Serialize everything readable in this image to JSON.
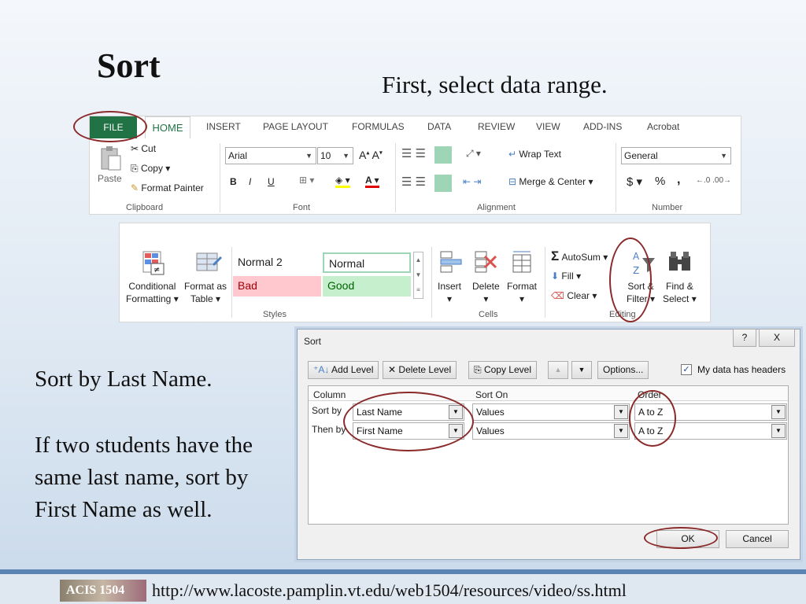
{
  "slide": {
    "title": "Sort",
    "subtitle": "First, select data range.",
    "note1": "Sort by Last Name.",
    "note2": "If two students have the same last name, sort by First Name as well.",
    "footer_badge": "ACIS 1504",
    "footer_url": "http://www.lacoste.pamplin.vt.edu/web1504/resources/video/ss.html"
  },
  "ribbon": {
    "tabs": [
      "FILE",
      "HOME",
      "INSERT",
      "PAGE LAYOUT",
      "FORMULAS",
      "DATA",
      "REVIEW",
      "VIEW",
      "ADD-INS",
      "Acrobat"
    ],
    "clipboard": {
      "paste": "Paste",
      "cut": "Cut",
      "copy": "Copy",
      "format_painter": "Format Painter",
      "group": "Clipboard"
    },
    "font": {
      "name": "Arial",
      "size": "10",
      "bold": "B",
      "italic": "I",
      "underline": "U",
      "group": "Font"
    },
    "alignment": {
      "wrap_text": "Wrap Text",
      "merge_center": "Merge & Center",
      "group": "Alignment"
    },
    "number": {
      "format": "General",
      "currency": "$",
      "percent": "%",
      "comma": ",",
      "group": "Number"
    }
  },
  "ribbon2": {
    "conditional_formatting": [
      "Conditional",
      "Formatting"
    ],
    "format_as_table": [
      "Format as",
      "Table"
    ],
    "styles": [
      {
        "label": "Normal 2",
        "bg": "#ffffff",
        "color": "#222222"
      },
      {
        "label": "Normal",
        "bg": "#ffffff",
        "color": "#222222"
      },
      {
        "label": "Bad",
        "bg": "#ffc7ce",
        "color": "#9c0006"
      },
      {
        "label": "Good",
        "bg": "#c6efce",
        "color": "#006100"
      }
    ],
    "styles_group": "Styles",
    "cells": {
      "insert": "Insert",
      "delete": "Delete",
      "format": "Format",
      "group": "Cells"
    },
    "editing": {
      "autosum": "AutoSum",
      "fill": "Fill",
      "clear": "Clear",
      "sort_filter": [
        "Sort &",
        "Filter"
      ],
      "find_select": [
        "Find &",
        "Select"
      ],
      "group": "Editing"
    }
  },
  "sort_dialog": {
    "title": "Sort",
    "help": "?",
    "close": "X",
    "add_level": "Add Level",
    "delete_level": "Delete Level",
    "copy_level": "Copy Level",
    "options": "Options...",
    "headers_label": "My data has headers",
    "headers_checked": true,
    "columns": {
      "column": "Column",
      "sort_on": "Sort On",
      "order": "Order"
    },
    "rows": [
      {
        "label": "Sort by",
        "column": "Last Name",
        "sort_on": "Values",
        "order": "A to Z"
      },
      {
        "label": "Then by",
        "column": "First Name",
        "sort_on": "Values",
        "order": "A to Z"
      }
    ],
    "ok": "OK",
    "cancel": "Cancel"
  }
}
